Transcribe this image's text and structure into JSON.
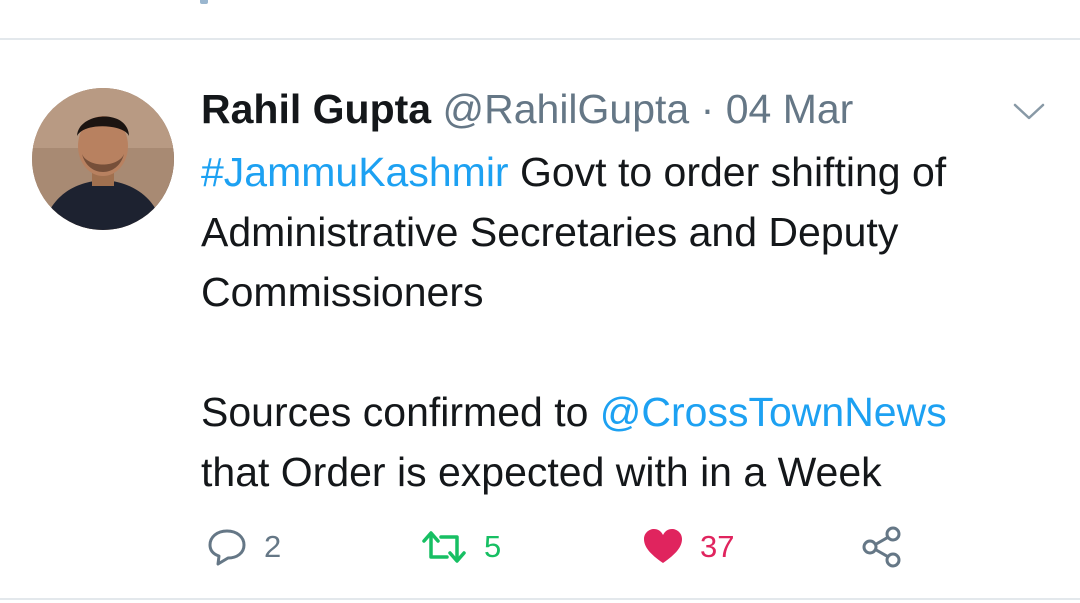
{
  "tweet": {
    "author_name": "Rahil Gupta",
    "author_handle": "@RahilGupta",
    "separator": "·",
    "timestamp": "04 Mar",
    "hashtag": "#JammuKashmir",
    "text_line1_rest": " Govt to order shifting of",
    "text_line2": "Administrative Secretaries and Deputy",
    "text_line3": "Commissioners",
    "text_line4_start": "Sources confirmed to ",
    "mention": "@CrossTownNews",
    "text_line5": "that Order is expected with in a Week"
  },
  "actions": {
    "reply_icon": "reply-icon",
    "reply_count": "2",
    "retweet_icon": "retweet-icon",
    "retweet_count": "5",
    "like_icon": "heart-icon",
    "like_count": "37",
    "share_icon": "share-icon"
  },
  "colors": {
    "link": "#1da1f2",
    "retweet": "#17bf63",
    "like": "#e0245e",
    "muted": "#657786",
    "text": "#14171a"
  }
}
